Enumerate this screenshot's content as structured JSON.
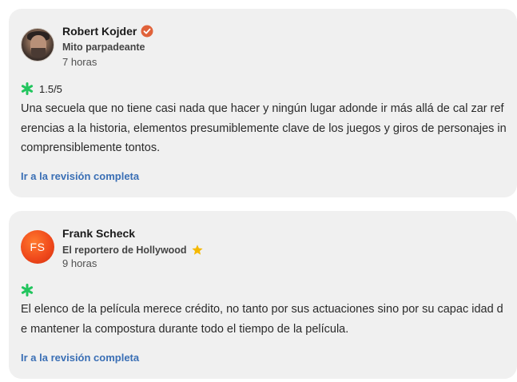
{
  "reviews": [
    {
      "author": "Robert Kojder",
      "verified_badge": "verified-check-icon",
      "affiliation": "Mito parpadeante",
      "time": "7 horas",
      "rating": "1.5/5",
      "text": "Una secuela que no tiene casi nada que hacer y ningún lugar adonde ir más allá de cal zar referencias a la historia, elementos presumiblemente clave de los juegos y giros de personajes incomprensiblemente tontos.",
      "link": "Ir a la revisión completa"
    },
    {
      "author": "Frank Scheck",
      "initials": "FS",
      "affiliation": "El reportero de Hollywood",
      "affiliation_badge": "star-icon",
      "time": "9 horas",
      "rating": "",
      "text": "El elenco de la película merece crédito, no tanto por sus actuaciones sino por su capac idad de mantener la compostura durante todo el tiempo de la película.",
      "link": "Ir a la revisión completa"
    }
  ],
  "colors": {
    "card_bg": "#f0f0f0",
    "splat_green": "#22c55e",
    "link_blue": "#3a6fb5",
    "verified_orange": "#e0623a",
    "star_gold": "#f5b800",
    "initials_avatar": "#f04a1c"
  }
}
